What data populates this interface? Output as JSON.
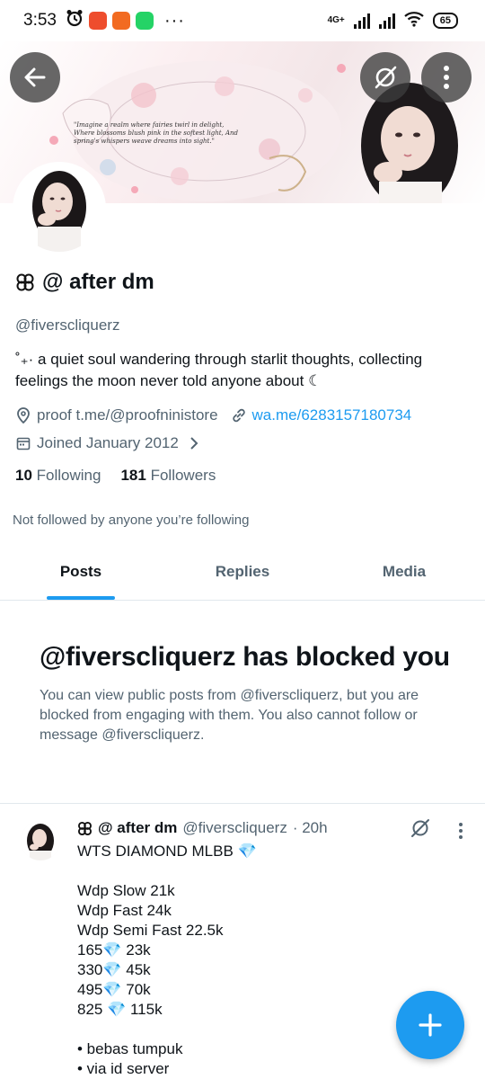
{
  "status_bar": {
    "time": "3:53",
    "dots": "···",
    "network": "4G+",
    "battery": "65"
  },
  "banner": {
    "quote": "\"Imagine a realm where fairies twirl in delight, Where blossoms blush pink in the softest light, And spring's whispers weave dreams into sight.\""
  },
  "profile": {
    "display_name": "@ after dm",
    "handle": "@fiverscliquerz",
    "bio": "˚₊· a quiet soul wandering through starlit thoughts, collecting feelings the moon never told anyone about ☾",
    "location": "proof t.me/@proofninistore",
    "website": "wa.me/6283157180734",
    "joined": "Joined January 2012",
    "following_count": "10",
    "following_label": "Following",
    "followers_count": "181",
    "followers_label": "Followers",
    "not_followed": "Not followed by anyone you’re following"
  },
  "tabs": [
    {
      "label": "Posts",
      "active": true
    },
    {
      "label": "Replies",
      "active": false
    },
    {
      "label": "Media",
      "active": false
    }
  ],
  "blocked": {
    "title": "@fiverscliquerz has blocked you",
    "text": "You can view public posts from @fiverscliquerz, but you are blocked from engaging with them. You also cannot follow or message @fiverscliquerz."
  },
  "post": {
    "name": "@ after dm",
    "handle": "@fiverscliquerz",
    "time": "· 20h",
    "lines": [
      "WTS DIAMOND MLBB 💎",
      "",
      "Wdp Slow 21k",
      "Wdp Fast 24k",
      "Wdp Semi Fast 22.5k",
      "165💎 23k",
      "330💎 45k",
      "495💎 70k",
      "825 💎 115k",
      "",
      "• bebas tumpuk",
      "• via id server"
    ]
  },
  "colors": {
    "accent": "#1d9bf0",
    "secondary_text": "#536471",
    "primary_text": "#0f1419"
  }
}
